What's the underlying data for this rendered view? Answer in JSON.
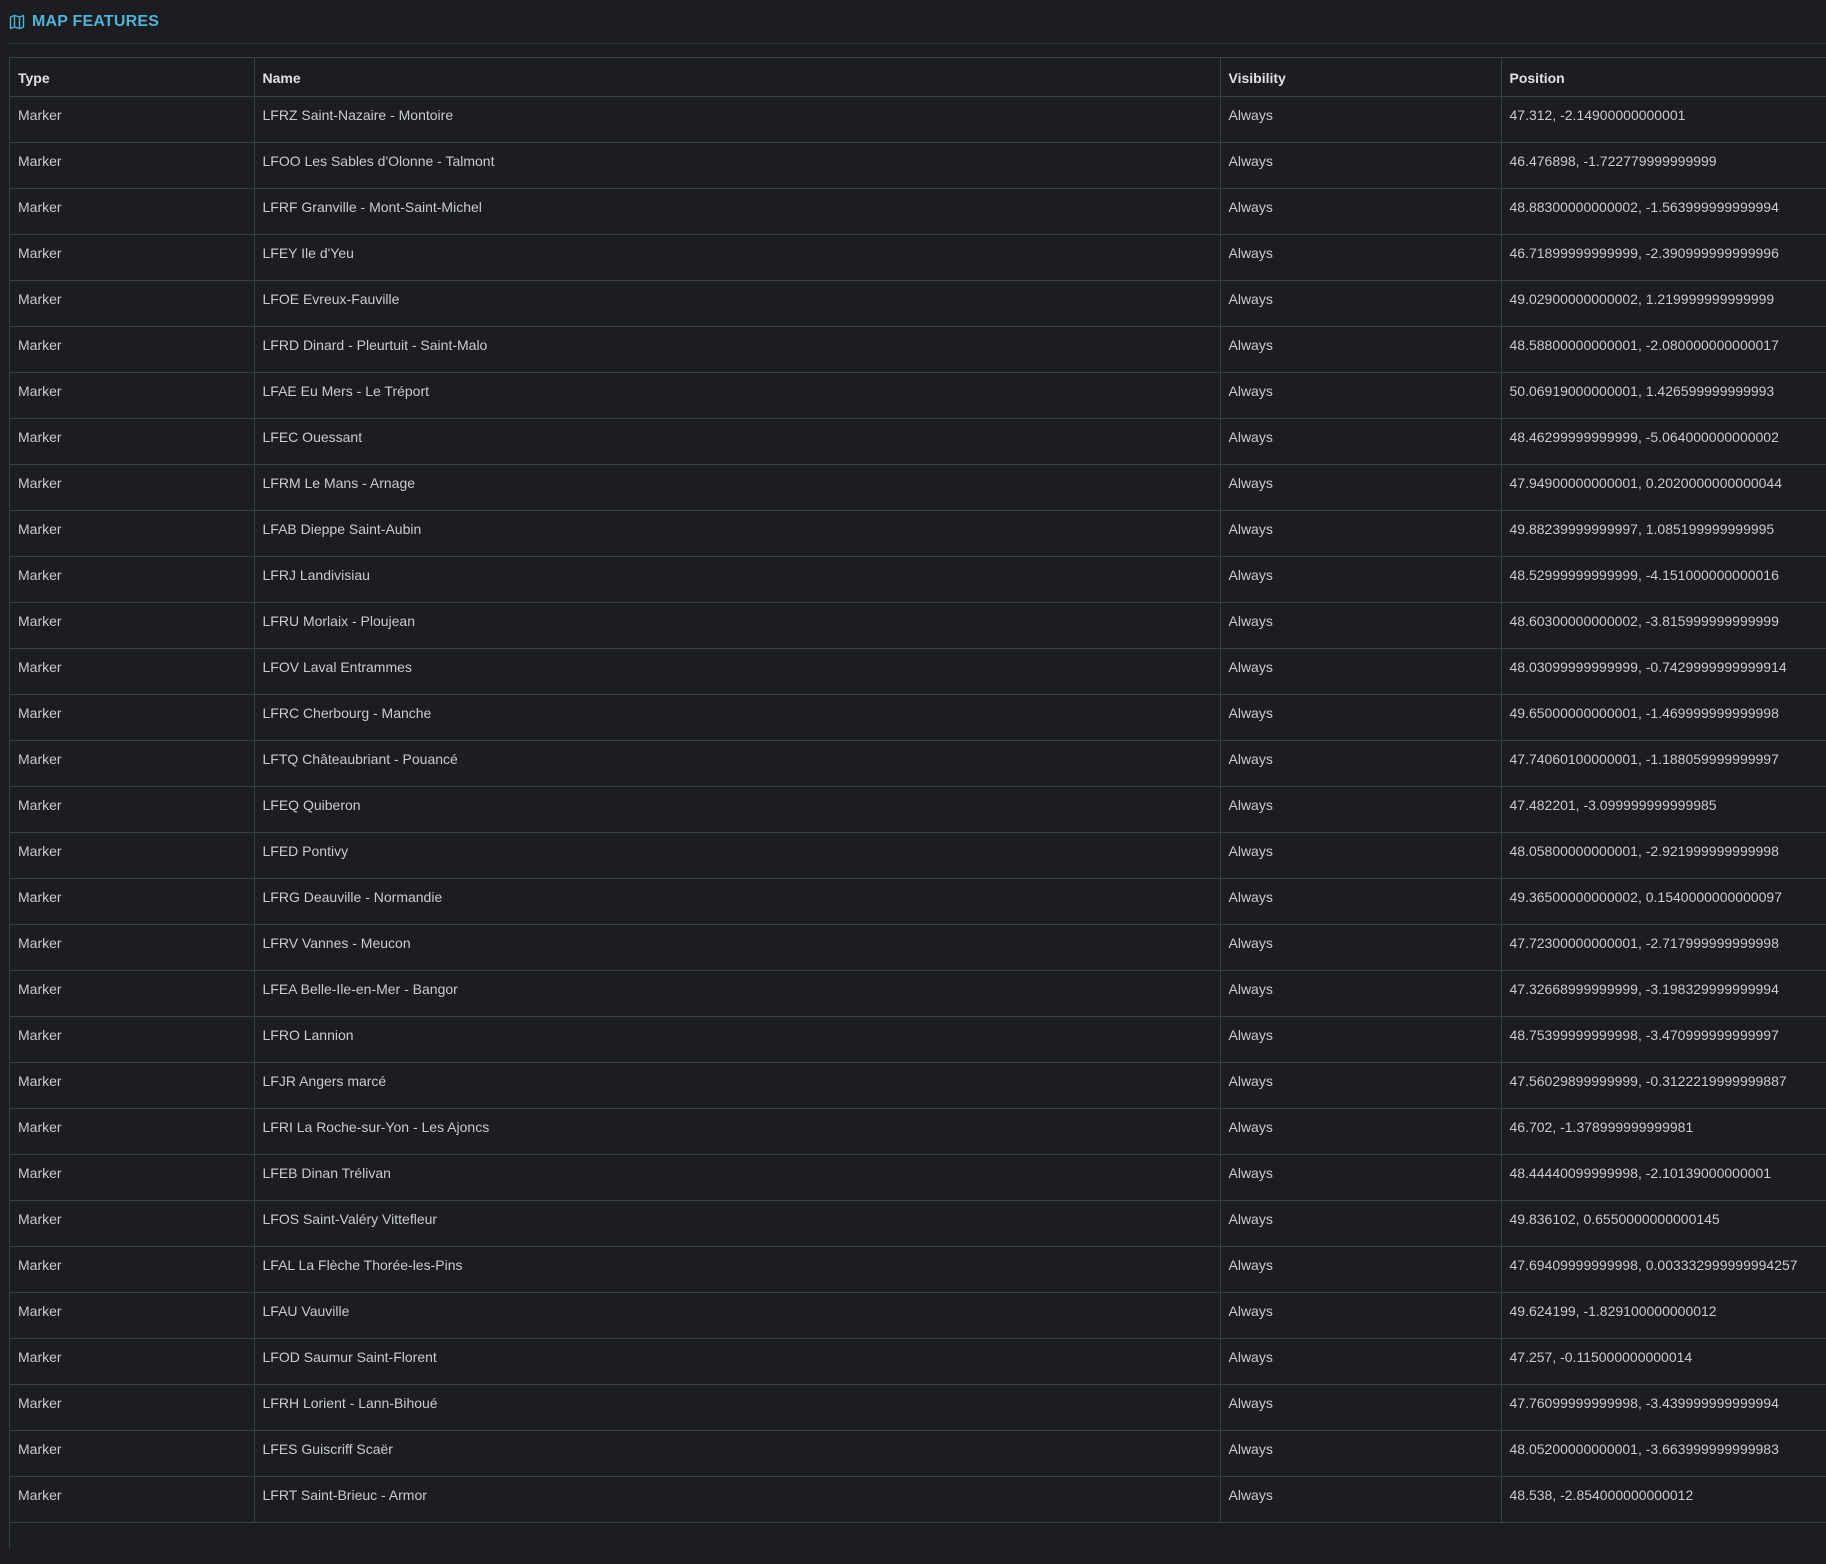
{
  "panel": {
    "title": "MAP FEATURES",
    "icon": "map-icon"
  },
  "table": {
    "columns": [
      "Type",
      "Name",
      "Visibility",
      "Position"
    ],
    "rows": [
      {
        "type": "Marker",
        "name": "LFRZ Saint-Nazaire - Montoire",
        "visibility": "Always",
        "position": "47.312, -2.14900000000001"
      },
      {
        "type": "Marker",
        "name": "LFOO Les Sables d'Olonne - Talmont",
        "visibility": "Always",
        "position": "46.476898, -1.722779999999999"
      },
      {
        "type": "Marker",
        "name": "LFRF Granville - Mont-Saint-Michel",
        "visibility": "Always",
        "position": "48.88300000000002, -1.563999999999994"
      },
      {
        "type": "Marker",
        "name": "LFEY Ile d'Yeu",
        "visibility": "Always",
        "position": "46.71899999999999, -2.390999999999996"
      },
      {
        "type": "Marker",
        "name": "LFOE Evreux-Fauville",
        "visibility": "Always",
        "position": "49.02900000000002, 1.219999999999999"
      },
      {
        "type": "Marker",
        "name": "LFRD Dinard - Pleurtuit - Saint-Malo",
        "visibility": "Always",
        "position": "48.58800000000001, -2.080000000000017"
      },
      {
        "type": "Marker",
        "name": "LFAE Eu Mers - Le Tréport",
        "visibility": "Always",
        "position": "50.06919000000001, 1.426599999999993"
      },
      {
        "type": "Marker",
        "name": "LFEC Ouessant",
        "visibility": "Always",
        "position": "48.46299999999999, -5.064000000000002"
      },
      {
        "type": "Marker",
        "name": "LFRM Le Mans - Arnage",
        "visibility": "Always",
        "position": "47.94900000000001, 0.2020000000000044"
      },
      {
        "type": "Marker",
        "name": "LFAB Dieppe Saint-Aubin",
        "visibility": "Always",
        "position": "49.88239999999997, 1.085199999999995"
      },
      {
        "type": "Marker",
        "name": "LFRJ Landivisiau",
        "visibility": "Always",
        "position": "48.52999999999999, -4.151000000000016"
      },
      {
        "type": "Marker",
        "name": "LFRU Morlaix - Ploujean",
        "visibility": "Always",
        "position": "48.60300000000002, -3.815999999999999"
      },
      {
        "type": "Marker",
        "name": "LFOV Laval Entrammes",
        "visibility": "Always",
        "position": "48.03099999999999, -0.7429999999999914"
      },
      {
        "type": "Marker",
        "name": "LFRC Cherbourg - Manche",
        "visibility": "Always",
        "position": "49.65000000000001, -1.469999999999998"
      },
      {
        "type": "Marker",
        "name": "LFTQ Châteaubriant - Pouancé",
        "visibility": "Always",
        "position": "47.74060100000001, -1.188059999999997"
      },
      {
        "type": "Marker",
        "name": "LFEQ Quiberon",
        "visibility": "Always",
        "position": "47.482201, -3.099999999999985"
      },
      {
        "type": "Marker",
        "name": "LFED Pontivy",
        "visibility": "Always",
        "position": "48.05800000000001, -2.921999999999998"
      },
      {
        "type": "Marker",
        "name": "LFRG Deauville - Normandie",
        "visibility": "Always",
        "position": "49.36500000000002, 0.1540000000000097"
      },
      {
        "type": "Marker",
        "name": "LFRV Vannes - Meucon",
        "visibility": "Always",
        "position": "47.72300000000001, -2.717999999999998"
      },
      {
        "type": "Marker",
        "name": "LFEA Belle-Ile-en-Mer - Bangor",
        "visibility": "Always",
        "position": "47.32668999999999, -3.198329999999994"
      },
      {
        "type": "Marker",
        "name": "LFRO Lannion",
        "visibility": "Always",
        "position": "48.75399999999998, -3.470999999999997"
      },
      {
        "type": "Marker",
        "name": "LFJR Angers marcé",
        "visibility": "Always",
        "position": "47.56029899999999, -0.3122219999999887"
      },
      {
        "type": "Marker",
        "name": "LFRI La Roche-sur-Yon - Les Ajoncs",
        "visibility": "Always",
        "position": "46.702, -1.378999999999981"
      },
      {
        "type": "Marker",
        "name": "LFEB Dinan Trélivan",
        "visibility": "Always",
        "position": "48.44440099999998, -2.10139000000001"
      },
      {
        "type": "Marker",
        "name": "LFOS Saint-Valéry Vittefleur",
        "visibility": "Always",
        "position": "49.836102, 0.6550000000000145"
      },
      {
        "type": "Marker",
        "name": "LFAL La Flèche Thorée-les-Pins",
        "visibility": "Always",
        "position": "47.69409999999998, 0.003332999999994257"
      },
      {
        "type": "Marker",
        "name": "LFAU Vauville",
        "visibility": "Always",
        "position": "49.624199, -1.829100000000012"
      },
      {
        "type": "Marker",
        "name": "LFOD Saumur Saint-Florent",
        "visibility": "Always",
        "position": "47.257, -0.115000000000014"
      },
      {
        "type": "Marker",
        "name": "LFRH Lorient - Lann-Bihoué",
        "visibility": "Always",
        "position": "47.76099999999998, -3.439999999999994"
      },
      {
        "type": "Marker",
        "name": "LFES Guiscriff Scaër",
        "visibility": "Always",
        "position": "48.05200000000001, -3.663999999999983"
      },
      {
        "type": "Marker",
        "name": "LFRT Saint-Brieuc - Armor",
        "visibility": "Always",
        "position": "48.538, -2.854000000000012"
      }
    ]
  }
}
